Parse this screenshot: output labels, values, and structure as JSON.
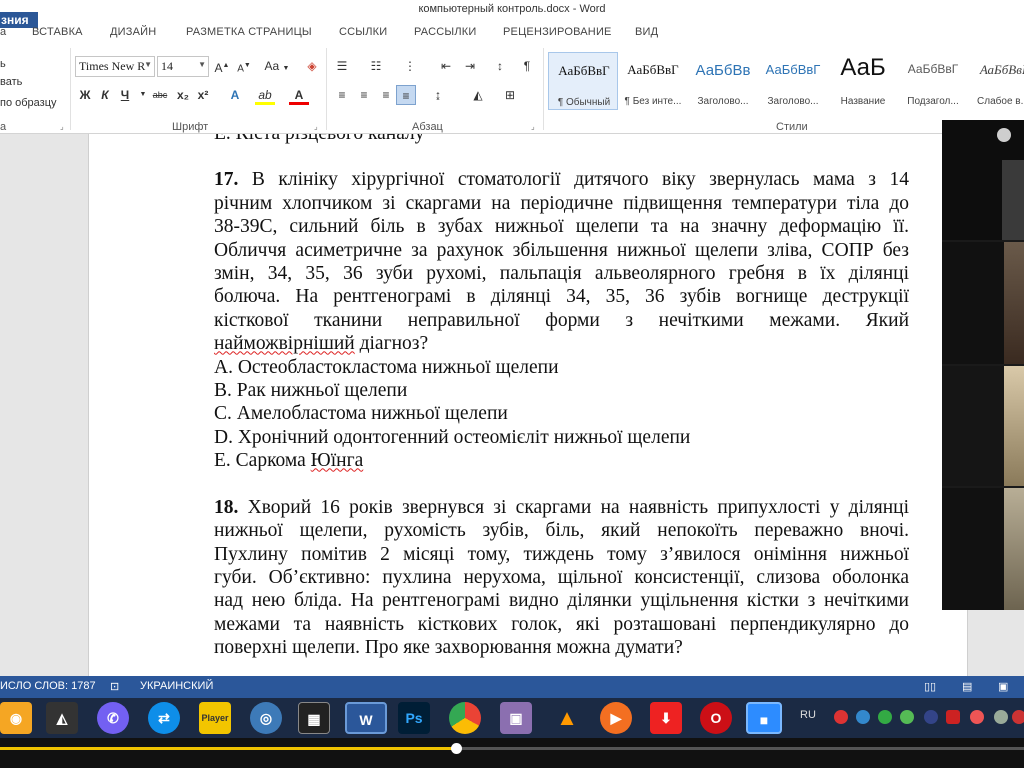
{
  "window": {
    "title": "компьютерный контроль.docx - Word",
    "corner_badge": "зния"
  },
  "tabs": [
    "а",
    "ВСТАВКА",
    "ДИЗАЙН",
    "РАЗМЕТКА СТРАНИЦЫ",
    "ССЫЛКИ",
    "РАССЫЛКИ",
    "РЕЦЕНЗИРОВАНИЕ",
    "ВИД"
  ],
  "ribbon": {
    "clipboard": {
      "items": [
        "ь",
        "вать",
        "по образцу"
      ],
      "label": "а"
    },
    "font": {
      "name": "Times New R",
      "size": "14",
      "grow": "A",
      "shrink": "A",
      "case": "Aa",
      "bold": "Ж",
      "italic": "К",
      "underline": "Ч",
      "strike": "abc",
      "sub": "x₂",
      "sup": "x²",
      "effects": "A",
      "highlight": "ab",
      "color": "A",
      "label": "Шрифт"
    },
    "paragraph": {
      "label": "Абзац",
      "pilcrow": "¶"
    },
    "styles": {
      "label": "Стили",
      "items": [
        {
          "sample": "АаБбВвГ",
          "name": "¶ Обычный",
          "sample_color": "#111111"
        },
        {
          "sample": "АаБбВвГ",
          "name": "¶ Без инте...",
          "sample_color": "#111111"
        },
        {
          "sample": "АаБбВв",
          "name": "Заголово...",
          "sample_color": "#2e74b5"
        },
        {
          "sample": "АаБбВвГ",
          "name": "Заголово...",
          "sample_color": "#2e74b5"
        },
        {
          "sample": "АаБ",
          "name": "Название",
          "sample_color": "#111111"
        },
        {
          "sample": "АаБбВвГ",
          "name": "Подзагол...",
          "sample_color": "#595959"
        },
        {
          "sample": "АаБбВвІ",
          "name": "Слабое в...",
          "sample_color": "#404040"
        }
      ]
    }
  },
  "document": {
    "prev_line": "Е. Кіста різцевого каналу",
    "q17": {
      "number": "17.",
      "lines": [
        "В клініку хірургічної стоматології дитячого віку звернулась мама з 14",
        "річним хлопчиком зі скаргами на періодичне підвищення температури тіла до",
        "38-39С, сильний біль в зубах нижньої щелепи та на значну деформацію її.",
        "Обличчя асиметричне за рахунок збільшення нижньої щелепи зліва, СОПР без",
        "змін, 34, 35, 36 зуби рухомі, пальпація альвеолярного гребня в їх ділянці",
        "болюча. На рентгенограмі в ділянці 34, 35, 36 зубів вогнище деструкції",
        "кісткової тканини неправильної форми з нечіткими межами. Який"
      ],
      "last_word": "найможвірніший",
      "last_rest": " діагноз?",
      "options": [
        "А. Остеобластокластома нижньої щелепи",
        "В. Рак нижньої щелепи",
        "С. Амелобластома нижньої щелепи",
        "D. Хронічний одонтогенний остеомієліт нижньої щелепи"
      ],
      "option_e_prefix": "Е. Саркома ",
      "option_e_word": "Юїнга"
    },
    "q18": {
      "number": "18.",
      "lines": [
        "Хворий 16 років звернувся зі скаргами на наявність припухлості у ділянці",
        "нижньої щелепи, рухомість зубів, біль, який непокоїть переважно вночі.",
        "Пухлину помітив 2 місяці тому, тиждень тому з’явилося оніміння нижньої",
        "губи. Об’єктивно: пухлина нерухома, щільної консистенції, слизова оболонка",
        "над нею бліда. На рентгенограмі видно ділянки ущільнення кістки з нечіткими",
        "межами та наявність кісткових голок, які розташовані перпендикулярно до",
        "поверхні щелепи. Про яке захворювання можна думати?"
      ]
    }
  },
  "statusbar": {
    "word_count": "ИСЛО СЛОВ: 1787",
    "language": "УКРАИНСКИЙ"
  },
  "taskbar": {
    "lang": "RU",
    "apps": [
      "audio-icon",
      "alien-icon",
      "viber-icon",
      "teamviewer-icon",
      "player-icon",
      "media-icon",
      "video-editor-icon",
      "word-icon",
      "photoshop-icon",
      "chrome-icon",
      "archiver-icon",
      "vlc-icon",
      "media-player-icon",
      "downloader-icon",
      "opera-icon",
      "zoom-icon"
    ],
    "app_labels": {
      "player": "Player",
      "word": "W",
      "photoshop": "Ps"
    }
  },
  "player": {
    "progress": 0.445
  }
}
